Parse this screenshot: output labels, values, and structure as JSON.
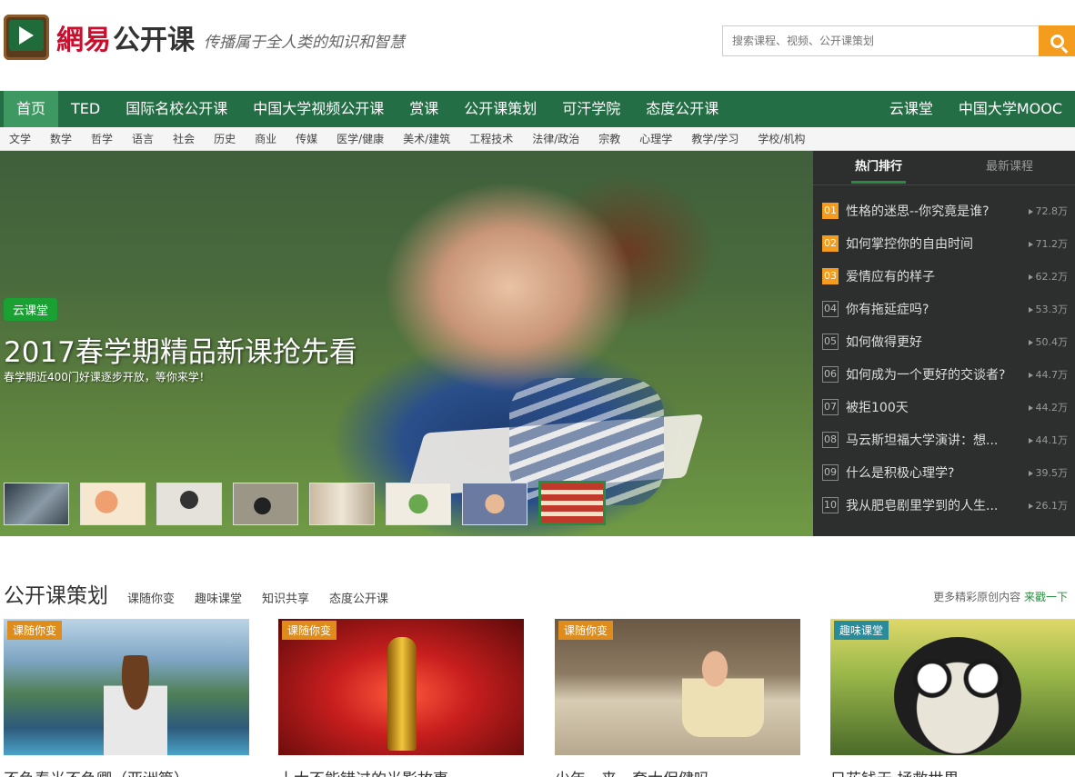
{
  "header": {
    "brand": "網易",
    "product": "公开课",
    "slogan": "传播属于全人类的知识和智慧",
    "search_placeholder": "搜索课程、视频、公开课策划"
  },
  "nav": {
    "items": [
      "首页",
      "TED",
      "国际名校公开课",
      "中国大学视频公开课",
      "赏课",
      "公开课策划",
      "可汗学院",
      "态度公开课"
    ],
    "right_items": [
      "云课堂",
      "中国大学MOOC"
    ]
  },
  "subnav": [
    "文学",
    "数学",
    "哲学",
    "语言",
    "社会",
    "历史",
    "商业",
    "传媒",
    "医学/健康",
    "美术/建筑",
    "工程技术",
    "法律/政治",
    "宗教",
    "心理学",
    "教学/学习",
    "学校/机构"
  ],
  "hero": {
    "badge": "云课堂",
    "title": "2017春学期精品新课抢先看",
    "subtitle": "春学期近400门好课逐步开放，等你来学！",
    "thumb_count": 8,
    "active_thumb": 8
  },
  "ranking": {
    "tabs": [
      "热门排行",
      "最新课程"
    ],
    "items": [
      {
        "num": "01",
        "title": "性格的迷思--你究竟是谁?",
        "views": "72.8万"
      },
      {
        "num": "02",
        "title": "如何掌控你的自由时间",
        "views": "71.2万"
      },
      {
        "num": "03",
        "title": "爱情应有的样子",
        "views": "62.2万"
      },
      {
        "num": "04",
        "title": "你有拖延症吗?",
        "views": "53.3万"
      },
      {
        "num": "05",
        "title": "如何做得更好",
        "views": "50.4万"
      },
      {
        "num": "06",
        "title": "如何成为一个更好的交谈者?",
        "views": "44.7万"
      },
      {
        "num": "07",
        "title": "被拒100天",
        "views": "44.2万"
      },
      {
        "num": "08",
        "title": "马云斯坦福大学演讲：想...",
        "views": "44.1万"
      },
      {
        "num": "09",
        "title": "什么是积极心理学?",
        "views": "39.5万"
      },
      {
        "num": "10",
        "title": "我从肥皂剧里学到的人生...",
        "views": "26.1万"
      }
    ]
  },
  "section": {
    "title": "公开课策划",
    "tabs": [
      "课随你变",
      "趣味课堂",
      "知识共享",
      "态度公开课"
    ],
    "more_text": "更多精彩原创内容",
    "more_link": "来戳一下"
  },
  "cards": [
    {
      "tag": "课随你变",
      "title": "不负春光不负卿（亚洲篇）"
    },
    {
      "tag": "课随你变",
      "title": "十大不能错过的光影故事"
    },
    {
      "tag": "课随你变",
      "title": "少年，来一套大保健吗"
    },
    {
      "tag": "趣味课堂",
      "title": "只花钱无 拯救世界"
    }
  ],
  "colors": {
    "nav_green": "#236e45",
    "nav_active": "#3d9961",
    "accent_orange": "#f39c1e",
    "badge_green": "#1aa033",
    "rank_bg": "#2d2f2e"
  }
}
